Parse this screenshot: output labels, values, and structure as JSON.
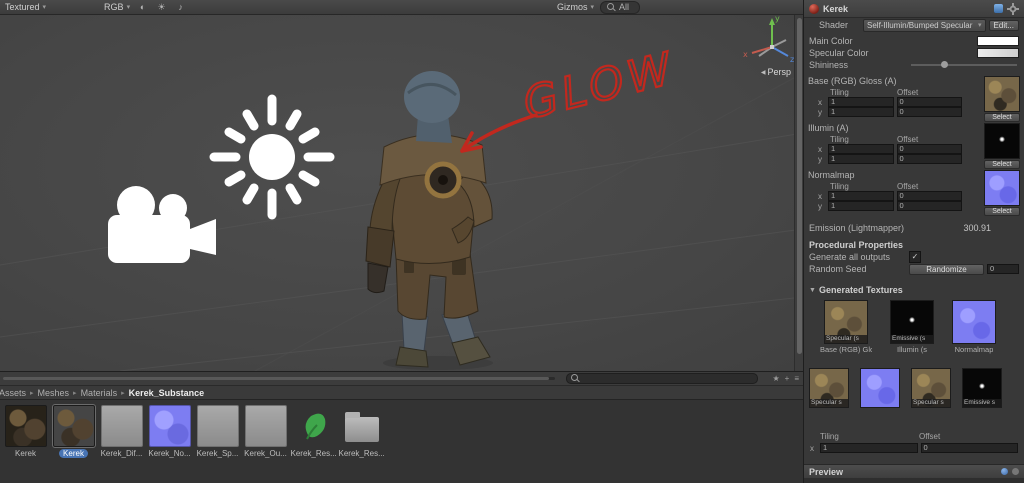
{
  "icons": {
    "caret": "▾",
    "arrow_right": "▸",
    "back_triangle": "◀",
    "foldout": "▼",
    "checkmark": "✓",
    "lighting": "☀",
    "audio": "♪",
    "effects": "◐",
    "star": "★",
    "plus": "+",
    "menu": "≡"
  },
  "colors": {
    "selection_blue": "#4874b4",
    "annotation_red": "#c2281e",
    "axis_x": "#c35b4e",
    "axis_y": "#6fbf4e",
    "axis_z": "#5588d9"
  },
  "scene_toolbar": {
    "draw_mode": "Textured",
    "render_mode": "RGB",
    "gizmos": "Gizmos",
    "search_value": "All"
  },
  "scene": {
    "persp": "Persp",
    "annotation": "GLOW",
    "axis": {
      "x": "x",
      "y": "y",
      "z": "z"
    }
  },
  "inspector": {
    "title": "Kerek",
    "shader_label": "Shader",
    "shader_value": "Self-Illumin/Bumped Specular",
    "edit_button": "Edit...",
    "main_color": "Main Color",
    "specular_color": "Specular Color",
    "shininess": "Shininess",
    "maps": [
      {
        "name": "Base (RGB) Gloss (A)",
        "tiling": "Tiling",
        "offset": "Offset",
        "x": "x",
        "y": "y",
        "tile_x": "1",
        "tile_y": "1",
        "off_x": "0",
        "off_y": "0",
        "select": "Select"
      },
      {
        "name": "Illumin (A)",
        "tiling": "Tiling",
        "offset": "Offset",
        "x": "x",
        "y": "y",
        "tile_x": "1",
        "tile_y": "1",
        "off_x": "0",
        "off_y": "0",
        "select": "Select"
      },
      {
        "name": "Normalmap",
        "tiling": "Tiling",
        "offset": "Offset",
        "x": "x",
        "y": "y",
        "tile_x": "1",
        "tile_y": "1",
        "off_x": "0",
        "off_y": "0",
        "select": "Select"
      }
    ],
    "emission_label": "Emission (Lightmapper)",
    "emission_value": "300.91",
    "procedural_header": "Procedural Properties",
    "generate_outputs": "Generate all outputs",
    "random_seed": "Random Seed",
    "randomize": "Randomize",
    "seed_value": "0",
    "generated_header": "Generated Textures",
    "gen_row1": [
      {
        "overlay": "Specular (s",
        "caption": "Base (RGB) Glo"
      },
      {
        "overlay": "Emissive (s",
        "caption": "Illumin (s"
      },
      {
        "overlay": "",
        "caption": "Normalmap"
      }
    ],
    "gen_row2": [
      {
        "overlay": "Specular s"
      },
      {
        "overlay": ""
      },
      {
        "overlay": "Specular s"
      },
      {
        "overlay": "Emissive s"
      }
    ],
    "gen_tiling": "Tiling",
    "gen_offset": "Offset",
    "gen_x": "x",
    "gen_tile_x": "1",
    "gen_off_x": "0",
    "preview": "Preview"
  },
  "project": {
    "breadcrumb": [
      {
        "label": "Assets"
      },
      {
        "label": "Meshes"
      },
      {
        "label": "Materials"
      },
      {
        "label": "Kerek_Substance"
      }
    ],
    "assets": [
      {
        "label": "Kerek"
      },
      {
        "label": "Kerek"
      },
      {
        "label": "Kerek_Dif..."
      },
      {
        "label": "Kerek_No..."
      },
      {
        "label": "Kerek_Sp..."
      },
      {
        "label": "Kerek_Ou..."
      },
      {
        "label": "Kerek_Res..."
      },
      {
        "label": "Kerek_Res..."
      }
    ]
  }
}
